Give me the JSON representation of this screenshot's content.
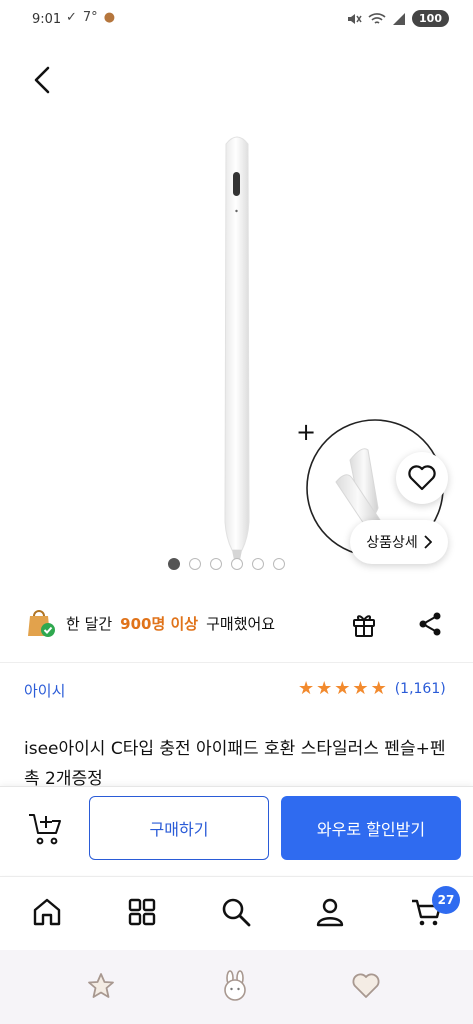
{
  "status_bar": {
    "time": "9:01",
    "temp": "7°",
    "battery": "100"
  },
  "gallery": {
    "dot_count": 6,
    "active_index": 0
  },
  "buttons": {
    "detail_label": "상품상세",
    "buy_label": "구매하기",
    "discount_label": "와우로 할인받기"
  },
  "purchase_info": {
    "prefix": "한 달간",
    "count": "900명 이상",
    "suffix": "구매했어요"
  },
  "product": {
    "brand": "아이시",
    "rating": 5,
    "review_count": "(1,161)",
    "title": "isee아이시 C타입 충전 아이패드 호환 스타일러스 펜슬+펜촉 2개증정"
  },
  "nav": {
    "cart_badge": "27",
    "items": [
      "home-icon",
      "category-icon",
      "search-icon",
      "profile-icon",
      "cart-icon"
    ]
  },
  "colors": {
    "brand_blue": "#2a5bd7",
    "cta_blue": "#2f6bf0",
    "star_orange": "#f28a2e",
    "highlight_orange": "#e0731a"
  }
}
